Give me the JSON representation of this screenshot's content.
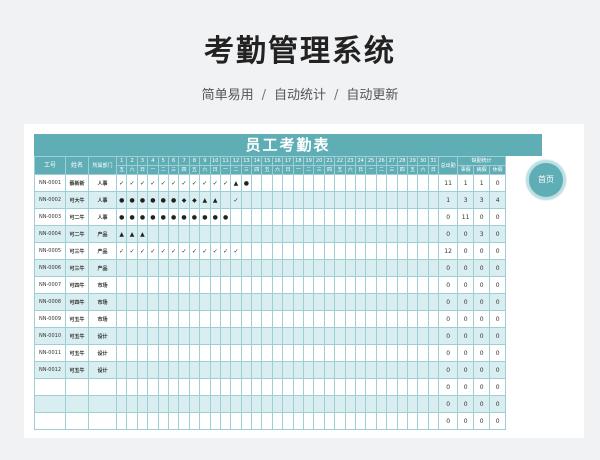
{
  "hero": {
    "title": "考勤管理系统",
    "subtitle": [
      "简单易用",
      "自动统计",
      "自动更新"
    ],
    "separator": "/"
  },
  "sheet": {
    "banner": "员工考勤表",
    "headers": {
      "id": "工号",
      "name": "姓名",
      "dept": "所属部门",
      "total": "总出勤",
      "stats": "缺勤统计",
      "stat_cols": [
        "事假",
        "病假",
        "休假"
      ]
    },
    "days": [
      "1",
      "2",
      "3",
      "4",
      "5",
      "6",
      "7",
      "8",
      "9",
      "10",
      "11",
      "12",
      "13",
      "14",
      "15",
      "16",
      "17",
      "18",
      "19",
      "20",
      "21",
      "22",
      "23",
      "24",
      "25",
      "26",
      "27",
      "28",
      "29",
      "30",
      "31"
    ],
    "weekdays": [
      "五",
      "六",
      "日",
      "一",
      "二",
      "三",
      "四",
      "五",
      "六",
      "日",
      "一",
      "二",
      "三",
      "四",
      "五",
      "六",
      "日",
      "一",
      "二",
      "三",
      "四",
      "五",
      "六",
      "日",
      "一",
      "二",
      "三",
      "四",
      "五",
      "六",
      "日"
    ],
    "rows": [
      {
        "id": "NN-0001",
        "name": "蔡新新",
        "dept": "人事",
        "marks": [
          "✓",
          "✓",
          "✓",
          "✓",
          "✓",
          "✓",
          "✓",
          "✓",
          "✓",
          "✓",
          "✓",
          "▲",
          "●",
          "",
          "",
          "",
          "",
          "",
          "",
          "",
          "",
          "",
          "",
          "",
          "",
          "",
          "",
          "",
          "",
          "",
          ""
        ],
        "total": "11",
        "s1": "1",
        "s2": "1",
        "s3": "0"
      },
      {
        "id": "NN-0002",
        "name": "可大牛",
        "dept": "人事",
        "marks": [
          "●",
          "●",
          "●",
          "●",
          "●",
          "●",
          "◆",
          "◆",
          "▲",
          "▲",
          "",
          "✓",
          "",
          "",
          "",
          "",
          "",
          "",
          "",
          "",
          "",
          "",
          "",
          "",
          "",
          "",
          "",
          "",
          "",
          "",
          ""
        ],
        "total": "1",
        "s1": "3",
        "s2": "3",
        "s3": "4"
      },
      {
        "id": "NN-0003",
        "name": "可二牛",
        "dept": "人事",
        "marks": [
          "●",
          "●",
          "●",
          "●",
          "●",
          "●",
          "●",
          "●",
          "●",
          "●",
          "●",
          "",
          "",
          "",
          "",
          "",
          "",
          "",
          "",
          "",
          "",
          "",
          "",
          "",
          "",
          "",
          "",
          "",
          "",
          "",
          ""
        ],
        "total": "0",
        "s1": "11",
        "s2": "0",
        "s3": "0"
      },
      {
        "id": "NN-0004",
        "name": "可二牛",
        "dept": "产品",
        "marks": [
          "▲",
          "▲",
          "▲",
          "",
          "",
          "",
          "",
          "",
          "",
          "",
          "",
          "",
          "",
          "",
          "",
          "",
          "",
          "",
          "",
          "",
          "",
          "",
          "",
          "",
          "",
          "",
          "",
          "",
          "",
          "",
          ""
        ],
        "total": "0",
        "s1": "0",
        "s2": "3",
        "s3": "0"
      },
      {
        "id": "NN-0005",
        "name": "可三牛",
        "dept": "产品",
        "marks": [
          "✓",
          "✓",
          "✓",
          "✓",
          "✓",
          "✓",
          "✓",
          "✓",
          "✓",
          "✓",
          "✓",
          "✓",
          "",
          "",
          "",
          "",
          "",
          "",
          "",
          "",
          "",
          "",
          "",
          "",
          "",
          "",
          "",
          "",
          "",
          "",
          ""
        ],
        "total": "12",
        "s1": "0",
        "s2": "0",
        "s3": "0"
      },
      {
        "id": "NN-0006",
        "name": "可三牛",
        "dept": "产品",
        "marks": [],
        "total": "0",
        "s1": "0",
        "s2": "0",
        "s3": "0"
      },
      {
        "id": "NN-0007",
        "name": "可四牛",
        "dept": "市场",
        "marks": [],
        "total": "0",
        "s1": "0",
        "s2": "0",
        "s3": "0"
      },
      {
        "id": "NN-0008",
        "name": "可四牛",
        "dept": "市场",
        "marks": [],
        "total": "0",
        "s1": "0",
        "s2": "0",
        "s3": "0"
      },
      {
        "id": "NN-0009",
        "name": "可五牛",
        "dept": "市场",
        "marks": [],
        "total": "0",
        "s1": "0",
        "s2": "0",
        "s3": "0"
      },
      {
        "id": "NN-0010",
        "name": "可五牛",
        "dept": "设计",
        "marks": [],
        "total": "0",
        "s1": "0",
        "s2": "0",
        "s3": "0"
      },
      {
        "id": "NN-0011",
        "name": "可五牛",
        "dept": "设计",
        "marks": [],
        "total": "0",
        "s1": "0",
        "s2": "0",
        "s3": "0"
      },
      {
        "id": "NN-0012",
        "name": "可五牛",
        "dept": "设计",
        "marks": [],
        "total": "0",
        "s1": "0",
        "s2": "0",
        "s3": "0"
      },
      {
        "id": "",
        "name": "",
        "dept": "",
        "marks": [],
        "total": "0",
        "s1": "0",
        "s2": "0",
        "s3": "0"
      },
      {
        "id": "",
        "name": "",
        "dept": "",
        "marks": [],
        "total": "0",
        "s1": "0",
        "s2": "0",
        "s3": "0"
      },
      {
        "id": "",
        "name": "",
        "dept": "",
        "marks": [],
        "total": "0",
        "s1": "0",
        "s2": "0",
        "s3": "0"
      }
    ]
  },
  "home_button": {
    "label": "首页"
  },
  "colors": {
    "accent": "#5faeb6",
    "stripe": "#d9eef0",
    "grid": "#9fcfd4"
  }
}
